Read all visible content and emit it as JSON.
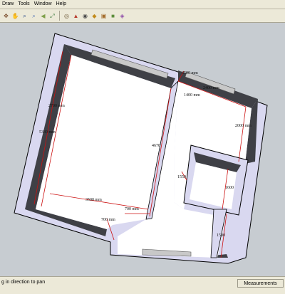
{
  "menu": {
    "items": [
      "Draw",
      "Tools",
      "Window",
      "Help"
    ]
  },
  "toolbar": {
    "groups": [
      {
        "name": "orbit",
        "tools": [
          {
            "icon": "orbit-icon",
            "glyph": "✥",
            "color": "#7a4b2a"
          },
          {
            "icon": "pan-icon",
            "glyph": "✋",
            "color": "#c58b4a"
          },
          {
            "icon": "zoom-icon",
            "glyph": "⌕",
            "color": "#2f4f8a"
          },
          {
            "icon": "zoom-window-icon",
            "glyph": "⌕",
            "color": "#5a7ab8"
          },
          {
            "icon": "previous-view-icon",
            "glyph": "◀",
            "color": "#7fa04a"
          },
          {
            "icon": "zoom-extents-icon",
            "glyph": "⤢",
            "color": "#3d7a3d"
          }
        ]
      },
      {
        "name": "views",
        "tools": [
          {
            "icon": "position-camera-icon",
            "glyph": "◎",
            "color": "#6e5a3a"
          },
          {
            "icon": "walk-icon",
            "glyph": "▲",
            "color": "#b83a2c"
          },
          {
            "icon": "look-around-icon",
            "glyph": "◉",
            "color": "#4a4a4a"
          },
          {
            "icon": "section-plane-icon",
            "glyph": "◆",
            "color": "#c28a1a"
          },
          {
            "icon": "scale-icon",
            "glyph": "▣",
            "color": "#a36b2a"
          },
          {
            "icon": "components-icon",
            "glyph": "■",
            "color": "#5d8e3c"
          },
          {
            "icon": "materials-icon",
            "glyph": "◈",
            "color": "#8e4ca8"
          }
        ]
      }
    ]
  },
  "dimensions": {
    "d3500_top": "3500 mm",
    "d2400_top": "2400 mm",
    "d1400": "1400 mm",
    "d2700_left": "2700 mm",
    "d5330": "5330 mm",
    "d2000_right": "2000 mm",
    "d4670": "4670",
    "d3500_bottom": "3500 mm",
    "d700_mid": "700 mm",
    "d700_door": "700 mm",
    "d1600": "1600",
    "d1500": "1500",
    "d1550": "1550"
  },
  "status": {
    "text": "g in direction to pan",
    "measurements_label": "Measurements"
  },
  "colors": {
    "background": "#c7ccd1",
    "wall_top": "#d9d8f0",
    "wall_side": "#3f4046",
    "floor": "#ffffff",
    "dimension_line": "#cc1111",
    "window": "#c8c8c8"
  }
}
